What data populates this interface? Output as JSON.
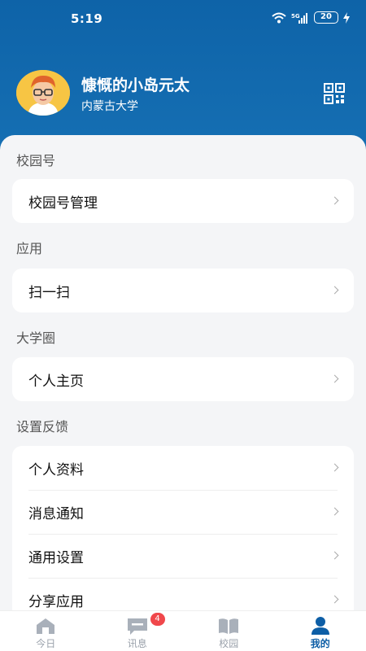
{
  "status_bar": {
    "time": "5:19",
    "network": "5G",
    "battery": "20"
  },
  "profile": {
    "name": "慷慨的小岛元太",
    "school": "内蒙古大学"
  },
  "sections": [
    {
      "title": "校园号",
      "items": [
        {
          "label": "校园号管理"
        }
      ]
    },
    {
      "title": "应用",
      "items": [
        {
          "label": "扫一扫"
        }
      ]
    },
    {
      "title": "大学圈",
      "items": [
        {
          "label": "个人主页"
        }
      ]
    },
    {
      "title": "设置反馈",
      "items": [
        {
          "label": "个人资料"
        },
        {
          "label": "消息通知"
        },
        {
          "label": "通用设置"
        },
        {
          "label": "分享应用"
        }
      ]
    }
  ],
  "tabs": [
    {
      "label": "今日",
      "icon": "home-icon"
    },
    {
      "label": "讯息",
      "icon": "message-icon",
      "badge": "4"
    },
    {
      "label": "校园",
      "icon": "book-icon"
    },
    {
      "label": "我的",
      "icon": "user-icon",
      "active": true
    }
  ],
  "colors": {
    "accent": "#0d5ea6",
    "header": "#0e63a8",
    "badge": "#f0474b"
  }
}
